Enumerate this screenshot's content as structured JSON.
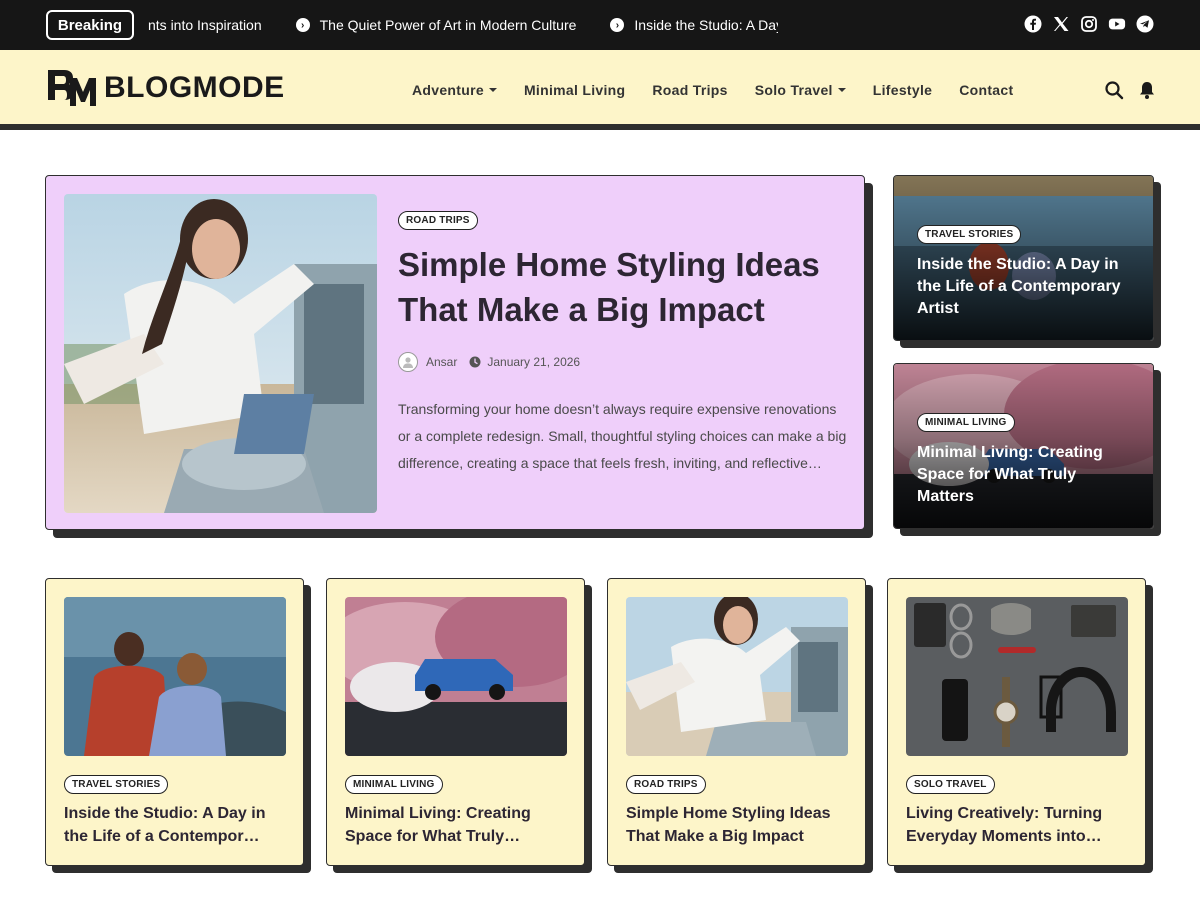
{
  "topbar": {
    "breaking_label": "Breaking",
    "ticker": [
      "nts into Inspiration",
      "The Quiet Power of Art in Modern Culture",
      "Inside the Studio: A Day in the"
    ],
    "socials": [
      "facebook-icon",
      "x-icon",
      "instagram-icon",
      "youtube-icon",
      "telegram-icon"
    ]
  },
  "header": {
    "logo_text": "BLOGMODE",
    "nav": [
      {
        "label": "Adventure",
        "dropdown": true
      },
      {
        "label": "Minimal Living",
        "dropdown": false
      },
      {
        "label": "Road Trips",
        "dropdown": false
      },
      {
        "label": "Solo Travel",
        "dropdown": true
      },
      {
        "label": "Lifestyle",
        "dropdown": false
      },
      {
        "label": "Contact",
        "dropdown": false
      }
    ]
  },
  "hero": {
    "category": "ROAD TRIPS",
    "title": "Simple Home Styling Ideas That Make a Big Impact",
    "author": "Ansar",
    "date": "January 21, 2026",
    "excerpt": "Transforming your home doesn’t always require expensive renovations or a complete redesign. Small, thoughtful styling choices can make a big difference, creating a space that feels fresh, inviting, and reflective…"
  },
  "side_cards": [
    {
      "category": "TRAVEL STORIES",
      "title": "Inside the Studio: A Day in the Life of a Contemporary Artist"
    },
    {
      "category": "MINIMAL LIVING",
      "title": "Minimal Living: Creating Space for What Truly Matters"
    }
  ],
  "grid_cards": [
    {
      "category": "TRAVEL STORIES",
      "title": "Inside the Studio: A Day in the Life of a Contempor…"
    },
    {
      "category": "MINIMAL LIVING",
      "title": "Minimal Living: Creating Space for What Truly…"
    },
    {
      "category": "ROAD TRIPS",
      "title": "Simple Home Styling Ideas That Make a Big Impact"
    },
    {
      "category": "SOLO TRAVEL",
      "title": "Living Creatively: Turning Everyday Moments into…"
    }
  ],
  "colors": {
    "topbar_bg": "#161616",
    "header_bg": "#fdf5c9",
    "hero_bg": "#efcffa",
    "card_bg": "#fdf5c9",
    "shadow": "#2e2e2e"
  }
}
